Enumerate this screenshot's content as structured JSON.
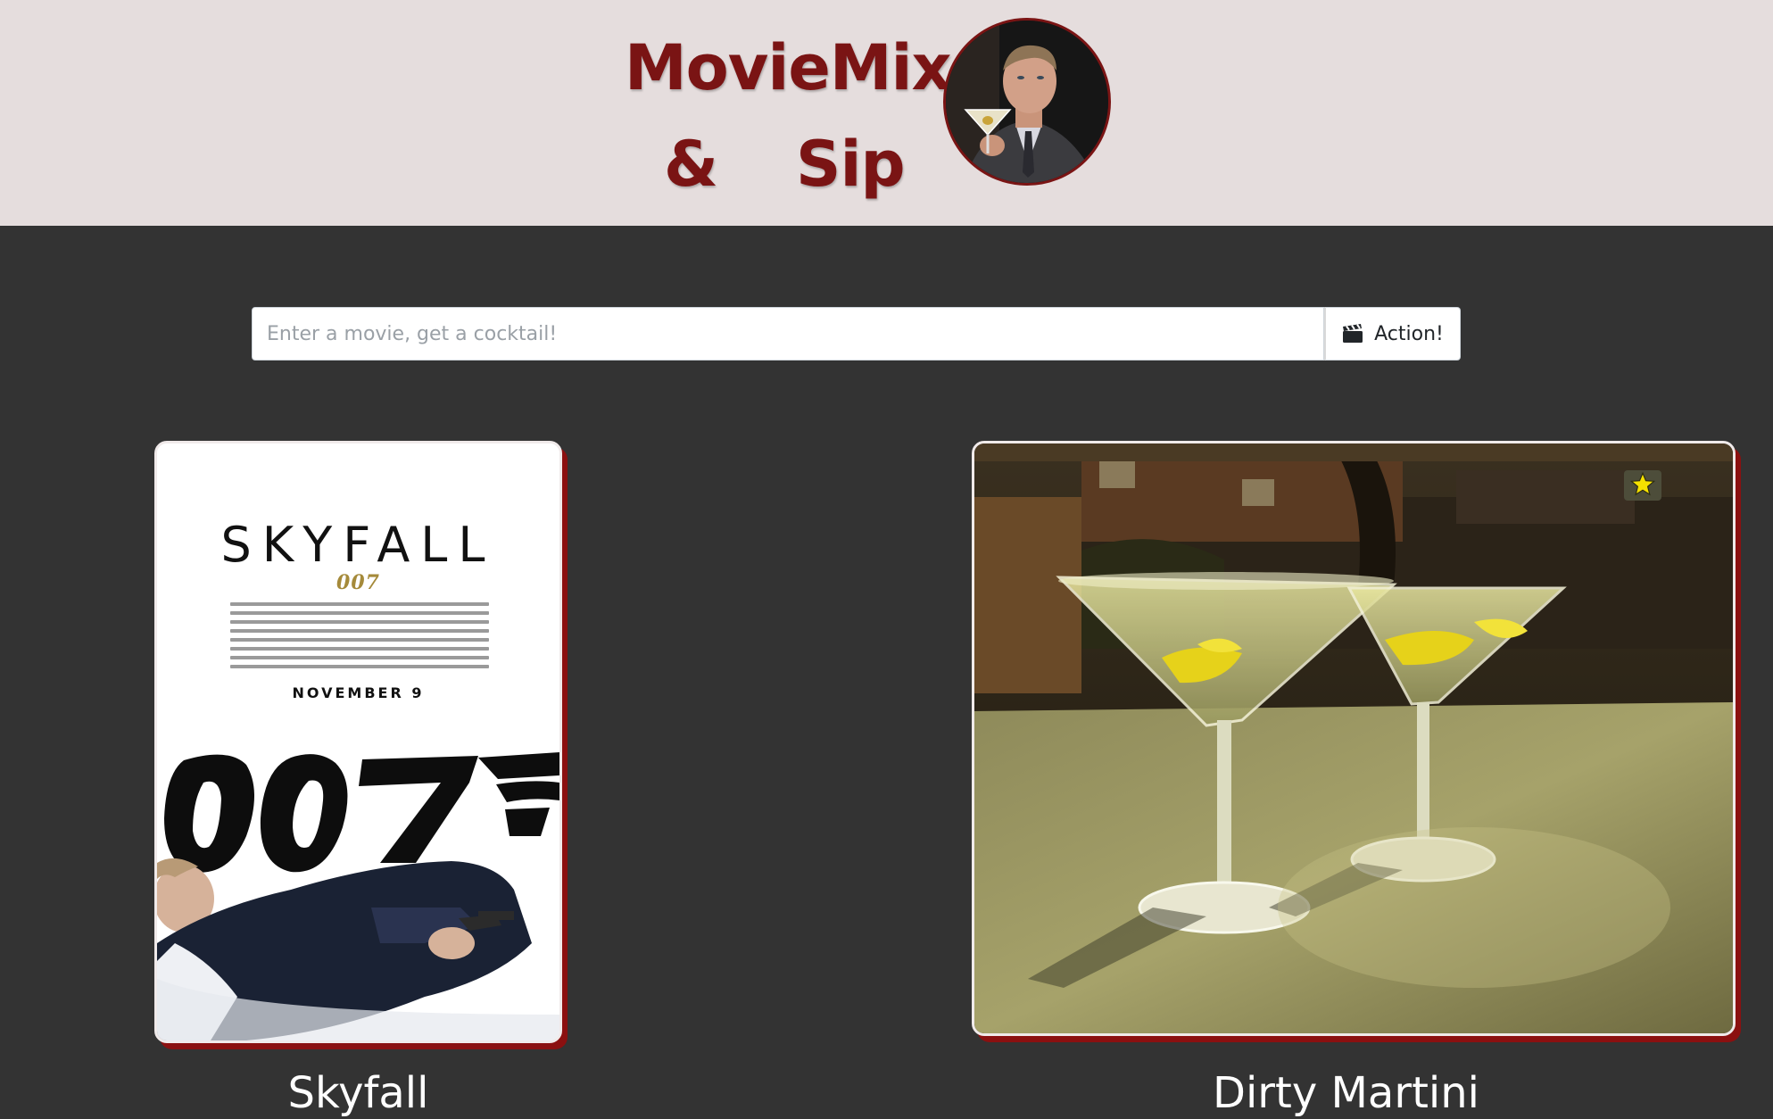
{
  "brand": {
    "title_line1": "MovieMix",
    "amp": "&",
    "sip": "Sip"
  },
  "search": {
    "placeholder": "Enter a movie, get a cocktail!",
    "value": "",
    "button_label": "Action!",
    "button_icon": "clapperboard-icon"
  },
  "movie": {
    "title": "Skyfall",
    "poster": {
      "headline": "SKYFALL",
      "subline": "007",
      "release": "NOVEMBER 9",
      "logo": "007"
    }
  },
  "cocktail": {
    "title": "Dirty Martini",
    "favorite_icon": "star-icon",
    "favorite_color": "#f5e100"
  },
  "colors": {
    "header_bg": "#e5dddd",
    "brand": "#7a1414",
    "page_bg": "#333333",
    "card_shadow": "#8b1010"
  }
}
